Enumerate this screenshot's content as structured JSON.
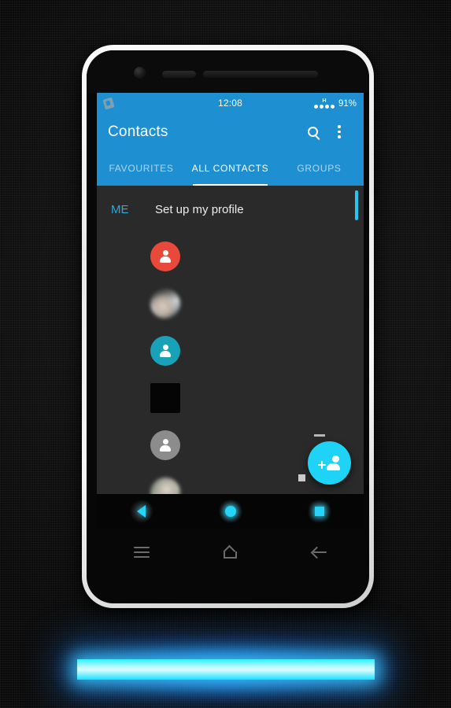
{
  "status_bar": {
    "notification_icon": "notification-badge-icon",
    "clock": "12:08",
    "network_type": "H",
    "signal_bars": 4,
    "battery": "91%"
  },
  "app_bar": {
    "title": "Contacts",
    "search_icon": "search-icon",
    "overflow_icon": "overflow-menu-icon"
  },
  "tabs": [
    {
      "label": "FAVOURITES",
      "active": false
    },
    {
      "label": "ALL CONTACTS",
      "active": true
    },
    {
      "label": "GROUPS",
      "active": false
    }
  ],
  "me_row": {
    "label": "ME",
    "action": "Set up my profile"
  },
  "contacts": [
    {
      "avatar_type": "icon",
      "avatar_color": "#e8493a",
      "name": ""
    },
    {
      "avatar_type": "photo-a",
      "avatar_color": "",
      "name": ""
    },
    {
      "avatar_type": "icon",
      "avatar_color": "#17a2b8",
      "name": ""
    },
    {
      "avatar_type": "square",
      "avatar_color": "#050505",
      "name": ""
    },
    {
      "avatar_type": "icon",
      "avatar_color": "#8c8c8c",
      "name": ""
    },
    {
      "avatar_type": "photo-b",
      "avatar_color": "",
      "name": ""
    }
  ],
  "fab": {
    "icon": "add-contact-icon",
    "color": "#1ed3f5"
  },
  "scrollbar": {
    "color": "#22c7f2"
  },
  "soft_nav": [
    {
      "icon": "back-triangle-icon"
    },
    {
      "icon": "home-circle-icon"
    },
    {
      "icon": "recents-square-icon"
    }
  ],
  "capacitive_keys": [
    {
      "icon": "menu-icon"
    },
    {
      "icon": "home-outline-icon"
    },
    {
      "icon": "back-arrow-icon"
    }
  ],
  "colors": {
    "accent_blue": "#1e90d2",
    "accent_cyan": "#1ed3f5",
    "list_background": "#2a2a2a",
    "me_label": "#2aa9e0"
  },
  "glow_bar": {
    "label": "glowing-light-bar",
    "color": "#2ff0ff"
  }
}
